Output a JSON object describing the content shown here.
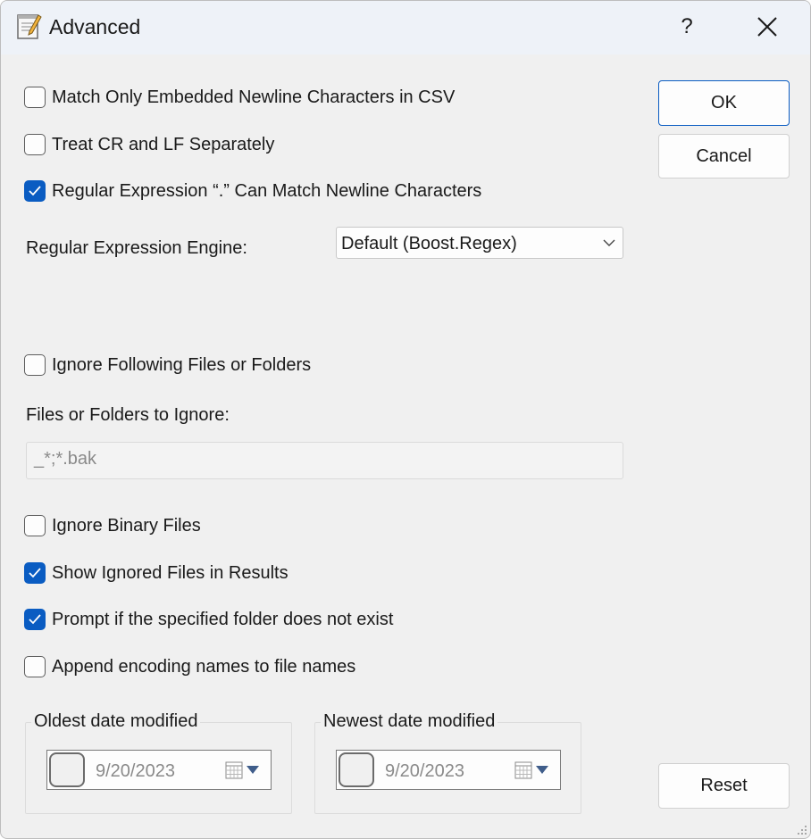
{
  "window": {
    "title": "Advanced",
    "help_label": "?"
  },
  "options": {
    "match_embedded_newline": {
      "label": "Match Only Embedded Newline Characters in CSV",
      "checked": false
    },
    "treat_cr_lf": {
      "label": "Treat CR and LF Separately",
      "checked": false
    },
    "regex_dot_newline": {
      "label": "Regular Expression “.” Can Match Newline Characters",
      "checked": true
    }
  },
  "regex_engine": {
    "label": "Regular Expression Engine:",
    "value": "Default (Boost.Regex)"
  },
  "ignore": {
    "checkbox": {
      "label": "Ignore Following Files or Folders",
      "checked": false
    },
    "field_label": "Files or Folders to Ignore:",
    "field_value": "_*;*.bak"
  },
  "binary_options": {
    "ignore_binary": {
      "label": "Ignore Binary Files",
      "checked": false
    },
    "show_ignored": {
      "label": "Show Ignored Files in Results",
      "checked": true
    },
    "prompt_folder": {
      "label": "Prompt if the specified folder does not exist",
      "checked": true
    },
    "append_encoding": {
      "label": "Append encoding names to file names",
      "checked": false
    }
  },
  "dates": {
    "oldest": {
      "label": "Oldest date modified",
      "value": "9/20/2023",
      "enabled": false
    },
    "newest": {
      "label": "Newest date modified",
      "value": "9/20/2023",
      "enabled": false
    }
  },
  "buttons": {
    "ok": "OK",
    "cancel": "Cancel",
    "reset": "Reset"
  },
  "colors": {
    "accent": "#0a5cc2",
    "dialog_bg": "#f0f0f0",
    "titlebar_bg": "#eef2f8"
  },
  "icons": {
    "app": "notepad-icon",
    "close": "close-icon",
    "dropdown": "chevron-down-icon",
    "calendar": "calendar-icon"
  }
}
